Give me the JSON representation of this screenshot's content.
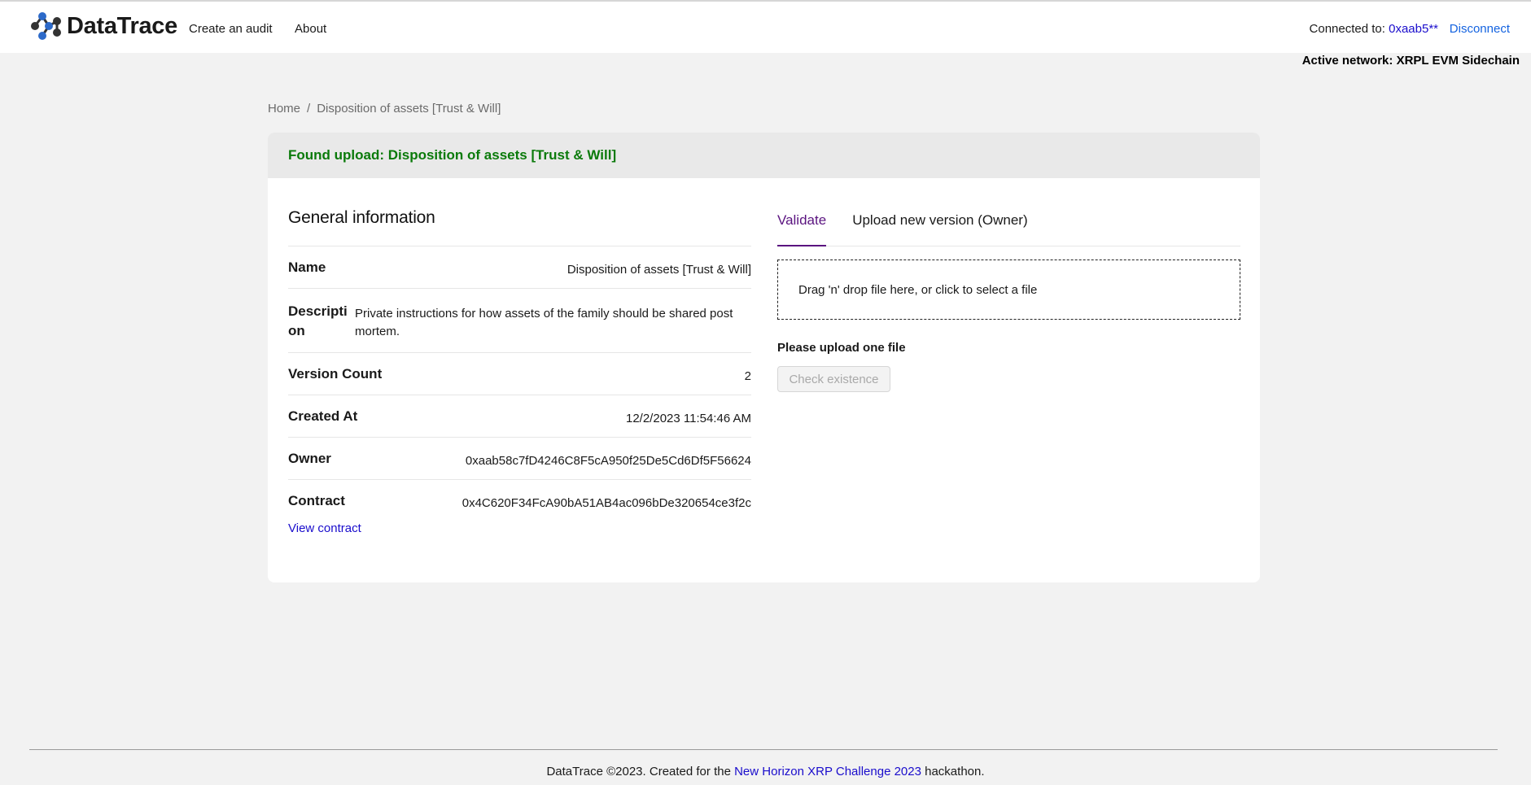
{
  "header": {
    "logo_text": "DataTrace",
    "nav": {
      "create": "Create an audit",
      "about": "About"
    },
    "connected_label": "Connected to:",
    "connected_address": "0xaab5**",
    "disconnect": "Disconnect",
    "active_network": "Active network: XRPL EVM Sidechain"
  },
  "breadcrumb": {
    "home": "Home",
    "separator": "/",
    "current": "Disposition of assets [Trust & Will]"
  },
  "card": {
    "header": "Found upload: Disposition of assets [Trust & Will]",
    "general": {
      "title": "General information",
      "rows": [
        {
          "label": "Name",
          "value": "Disposition of assets [Trust & Will]"
        },
        {
          "label": "Description",
          "value": "Private instructions for how assets of the family should be shared post mortem."
        },
        {
          "label": "Version Count",
          "value": "2"
        },
        {
          "label": "Created At",
          "value": "12/2/2023 11:54:46 AM"
        },
        {
          "label": "Owner",
          "value": "0xaab58c7fD4246C8F5cA950f25De5Cd6Df5F56624"
        },
        {
          "label": "Contract",
          "value": "0x4C620F34FcA90bA51AB4ac096bDe320654ce3f2c"
        }
      ],
      "view_contract": "View contract"
    },
    "tabs": [
      "Validate",
      "Upload new version (Owner)"
    ],
    "dropzone": "Drag 'n' drop file here, or click to select a file",
    "upload_note": "Please upload one file",
    "check_button": "Check existence"
  },
  "footer": {
    "prefix": "DataTrace ©2023. Created for the",
    "link": "New Horizon XRP Challenge 2023",
    "suffix": "hackathon."
  },
  "colors": {
    "accent_green": "#0a7a0a",
    "tab_active": "#5b1480",
    "link_blue": "#1a0dcc",
    "logo_blue": "#2d6ac9"
  }
}
